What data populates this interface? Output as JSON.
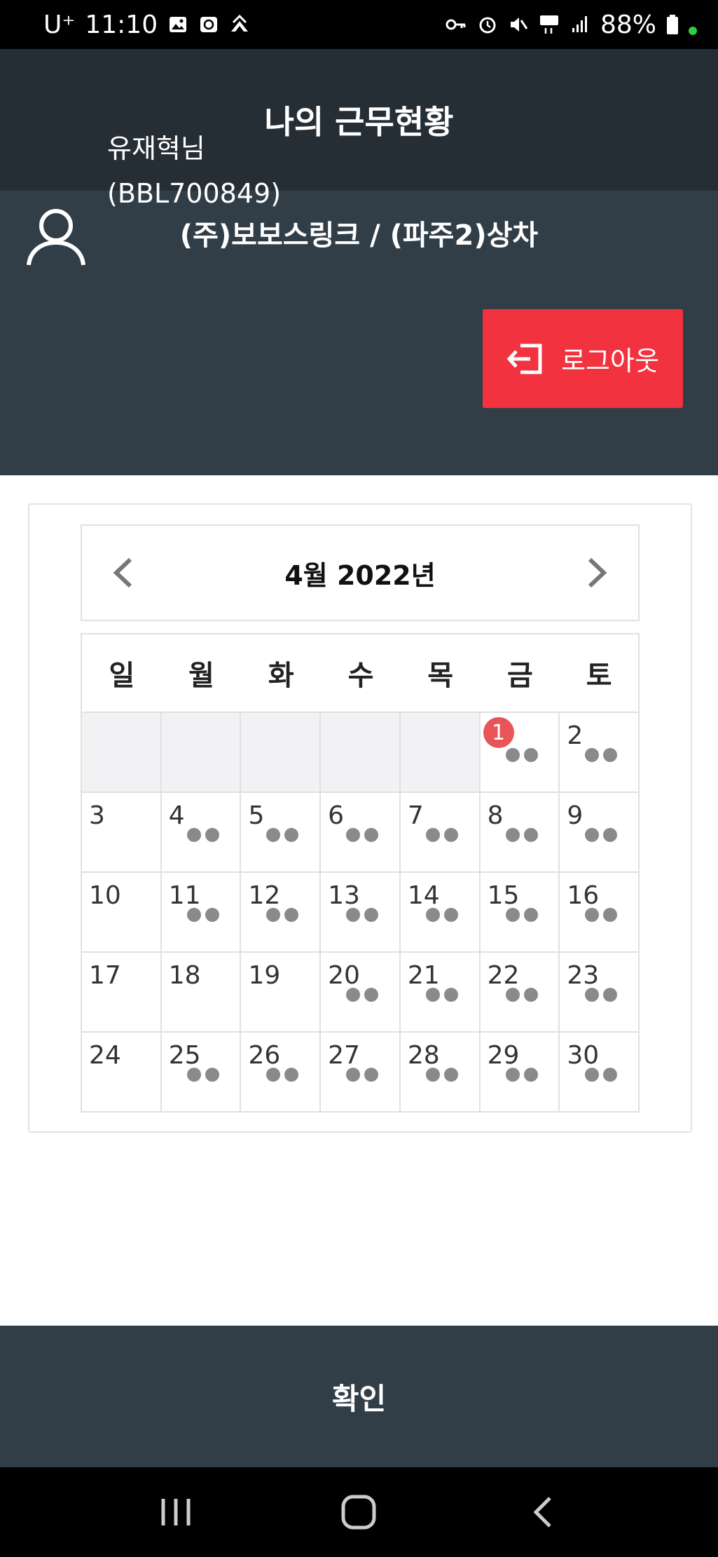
{
  "status_bar": {
    "carrier": "U⁺",
    "time": "11:10",
    "battery": "88%"
  },
  "header": {
    "title": "나의 근무현황"
  },
  "info": {
    "company": "(주)보보스링크 / (파주2)상차",
    "user_name": "유재혁님",
    "user_id": "(BBL700849)",
    "logout_label": "로그아웃"
  },
  "calendar": {
    "month_title": "4월 2022년",
    "weekdays": [
      "일",
      "월",
      "화",
      "수",
      "목",
      "금",
      "토"
    ],
    "weeks": [
      [
        null,
        null,
        null,
        null,
        null,
        {
          "day": "1",
          "today": true,
          "dots": 2
        },
        {
          "day": "2",
          "dots": 2
        }
      ],
      [
        {
          "day": "3",
          "dots": 0
        },
        {
          "day": "4",
          "dots": 2
        },
        {
          "day": "5",
          "dots": 2
        },
        {
          "day": "6",
          "dots": 2
        },
        {
          "day": "7",
          "dots": 2
        },
        {
          "day": "8",
          "dots": 2
        },
        {
          "day": "9",
          "dots": 2
        }
      ],
      [
        {
          "day": "10",
          "dots": 0
        },
        {
          "day": "11",
          "dots": 2
        },
        {
          "day": "12",
          "dots": 2
        },
        {
          "day": "13",
          "dots": 2
        },
        {
          "day": "14",
          "dots": 2
        },
        {
          "day": "15",
          "dots": 2
        },
        {
          "day": "16",
          "dots": 2
        }
      ],
      [
        {
          "day": "17",
          "dots": 0
        },
        {
          "day": "18",
          "dots": 0
        },
        {
          "day": "19",
          "dots": 0
        },
        {
          "day": "20",
          "dots": 2
        },
        {
          "day": "21",
          "dots": 2
        },
        {
          "day": "22",
          "dots": 2
        },
        {
          "day": "23",
          "dots": 2
        }
      ],
      [
        {
          "day": "24",
          "dots": 0
        },
        {
          "day": "25",
          "dots": 2
        },
        {
          "day": "26",
          "dots": 2
        },
        {
          "day": "27",
          "dots": 2
        },
        {
          "day": "28",
          "dots": 2
        },
        {
          "day": "29",
          "dots": 2
        },
        {
          "day": "30",
          "dots": 2
        }
      ]
    ]
  },
  "footer": {
    "confirm_label": "확인"
  },
  "colors": {
    "header_bg": "#252e35",
    "panel_bg": "#313e48",
    "logout_bg": "#f2323f",
    "today_badge": "#e85458",
    "dot": "#8a8a8a"
  }
}
